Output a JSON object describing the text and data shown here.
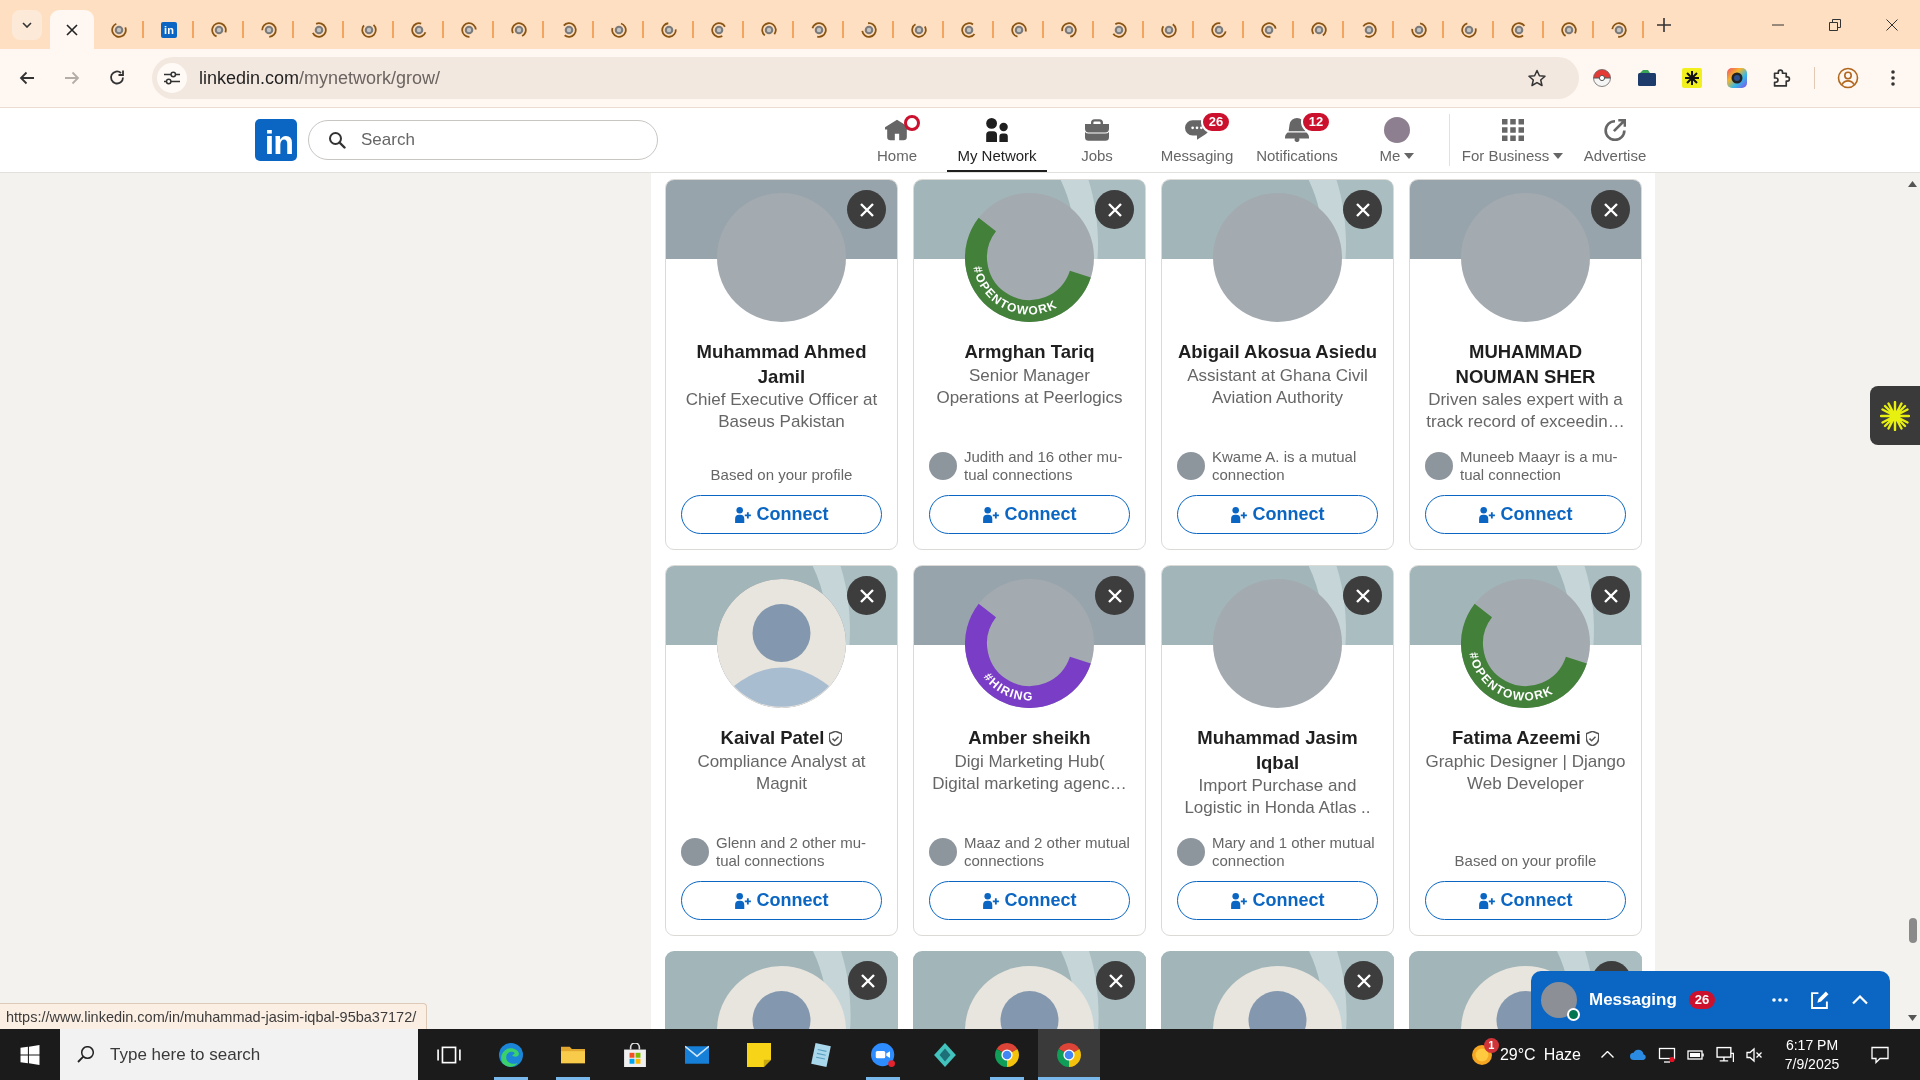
{
  "browser": {
    "tabs": [
      {
        "selected": true
      },
      {
        "selected": false,
        "kind": "loading"
      },
      {
        "selected": false,
        "kind": "logo",
        "logo": "in"
      },
      {
        "selected": false,
        "kind": "loading"
      },
      {
        "selected": false,
        "kind": "loading"
      },
      {
        "selected": false,
        "kind": "loading"
      },
      {
        "selected": false,
        "kind": "loading"
      },
      {
        "selected": false,
        "kind": "loading"
      },
      {
        "selected": false,
        "kind": "loading"
      },
      {
        "selected": false,
        "kind": "loading"
      },
      {
        "selected": false,
        "kind": "loading"
      },
      {
        "selected": false,
        "kind": "loading"
      },
      {
        "selected": false,
        "kind": "loading"
      },
      {
        "selected": false,
        "kind": "loading"
      },
      {
        "selected": false,
        "kind": "loading"
      },
      {
        "selected": false,
        "kind": "loading"
      },
      {
        "selected": false,
        "kind": "loading"
      },
      {
        "selected": false,
        "kind": "loading"
      },
      {
        "selected": false,
        "kind": "loading"
      },
      {
        "selected": false,
        "kind": "loading"
      },
      {
        "selected": false,
        "kind": "loading"
      },
      {
        "selected": false,
        "kind": "loading"
      },
      {
        "selected": false,
        "kind": "loading"
      },
      {
        "selected": false,
        "kind": "loading"
      },
      {
        "selected": false,
        "kind": "loading"
      },
      {
        "selected": false,
        "kind": "loading"
      },
      {
        "selected": false,
        "kind": "loading"
      },
      {
        "selected": false,
        "kind": "loading"
      },
      {
        "selected": false,
        "kind": "loading"
      },
      {
        "selected": false,
        "kind": "loading"
      },
      {
        "selected": false,
        "kind": "loading"
      },
      {
        "selected": false,
        "kind": "loading"
      }
    ],
    "nav_buttons": [
      {
        "kind": "back",
        "disabled": false
      },
      {
        "kind": "forward",
        "disabled": true
      },
      {
        "kind": "reload",
        "disabled": false
      }
    ],
    "address": {
      "host": "linkedin.com",
      "path": "/mynetwork/grow/"
    }
  },
  "header": {
    "logo": "in",
    "search": {
      "placeholder": "Search"
    },
    "nav": [
      {
        "kind": "home",
        "label": "Home",
        "selected": false,
        "dot": true,
        "dropdown": false
      },
      {
        "kind": "network",
        "label": "My Network",
        "selected": true,
        "dot": false,
        "dropdown": false
      },
      {
        "kind": "jobs",
        "label": "Jobs",
        "selected": false,
        "dot": false,
        "dropdown": false
      },
      {
        "kind": "messaging",
        "label": "Messaging",
        "selected": false,
        "dot": false,
        "dropdown": false,
        "badge": "26"
      },
      {
        "kind": "notifications",
        "label": "Notifications",
        "selected": false,
        "dot": false,
        "dropdown": false,
        "badge": "12"
      },
      {
        "kind": "me",
        "label": "Me",
        "selected": false,
        "dot": false,
        "dropdown": true
      },
      {
        "kind": "business",
        "label": "For Business",
        "selected": false,
        "dot": false,
        "dropdown": true
      },
      {
        "kind": "advertise",
        "label": "Advertise",
        "selected": false,
        "dot": false,
        "dropdown": false
      }
    ]
  },
  "cards": [
    {
      "banner": {
        "kind": "photo"
      },
      "avatar": {
        "kind": "photo"
      },
      "name": [
        "Muhammad Ahmed",
        "Jamil"
      ],
      "verified": false,
      "headline": [
        "Chief Executive Officer at",
        "Baseus Pakistan"
      ],
      "footer": {
        "kind": "note",
        "lines": [
          "Based on your profile"
        ]
      },
      "action": "Connect"
    },
    {
      "banner": {
        "kind": "default"
      },
      "avatar": {
        "kind": "photo"
      },
      "frame": {
        "kind": "open",
        "label": "#OPENTOWORK"
      },
      "name": [
        "Armghan Tariq"
      ],
      "verified": false,
      "headline": [
        "Senior Manager",
        "Operations at Peerlogics"
      ],
      "footer": {
        "kind": "mutual",
        "lines": [
          "Judith and 16 other mu-",
          "tual connections"
        ]
      },
      "action": "Connect"
    },
    {
      "banner": {
        "kind": "default"
      },
      "avatar": {
        "kind": "photo"
      },
      "name": [
        "Abigail Akosua Asiedu"
      ],
      "verified": false,
      "headline": [
        "Assistant at Ghana Civil",
        "Aviation Authority"
      ],
      "footer": {
        "kind": "mutual",
        "lines": [
          "Kwame A. is a mutual",
          "connection"
        ]
      },
      "action": "Connect"
    },
    {
      "banner": {
        "kind": "photo"
      },
      "avatar": {
        "kind": "photo"
      },
      "name": [
        "MUHAMMAD",
        "NOUMAN SHER"
      ],
      "verified": false,
      "headline": [
        "Driven sales expert with a",
        "track record of exceedin…"
      ],
      "footer": {
        "kind": "mutual",
        "lines": [
          "Muneeb Maayr is a mu-",
          "tual connection"
        ]
      },
      "action": "Connect"
    },
    {
      "banner": {
        "kind": "default"
      },
      "avatar": {
        "kind": "default"
      },
      "name": [
        "Kaival Patel"
      ],
      "verified": true,
      "headline": [
        "Compliance Analyst at",
        "Magnit"
      ],
      "footer": {
        "kind": "mutual",
        "lines": [
          "Glenn and 2 other mu-",
          "tual connections"
        ]
      },
      "action": "Connect"
    },
    {
      "banner": {
        "kind": "photo"
      },
      "avatar": {
        "kind": "photo"
      },
      "frame": {
        "kind": "hiring",
        "label": "#HIRING"
      },
      "name": [
        "Amber sheikh"
      ],
      "verified": false,
      "headline": [
        "Digi Marketing Hub(",
        "Digital marketing agenc…"
      ],
      "footer": {
        "kind": "mutual",
        "lines": [
          "Maaz and 2 other mutual",
          "connections"
        ]
      },
      "action": "Connect"
    },
    {
      "banner": {
        "kind": "default"
      },
      "avatar": {
        "kind": "photo"
      },
      "name": [
        "Muhammad Jasim",
        "Iqbal"
      ],
      "verified": false,
      "headline": [
        "Import Purchase and",
        "Logistic in Honda Atlas .."
      ],
      "footer": {
        "kind": "mutual",
        "lines": [
          "Mary and 1 other mutual",
          "connection"
        ]
      },
      "action": "Connect"
    },
    {
      "banner": {
        "kind": "default"
      },
      "avatar": {
        "kind": "photo"
      },
      "frame": {
        "kind": "open",
        "label": "#OPENTOWORK"
      },
      "name": [
        "Fatima Azeemi"
      ],
      "verified": true,
      "headline": [
        "Graphic Designer | Django",
        "Web Developer"
      ],
      "footer": {
        "kind": "note",
        "lines": [
          "Based on your profile"
        ]
      },
      "action": "Connect"
    },
    {
      "banner": {
        "kind": "default"
      },
      "avatar": {
        "kind": "default"
      }
    },
    {
      "banner": {
        "kind": "default"
      },
      "avatar": {
        "kind": "default"
      }
    },
    {
      "banner": {
        "kind": "default"
      },
      "avatar": {
        "kind": "default"
      }
    },
    {
      "banner": {
        "kind": "default"
      },
      "avatar": {
        "kind": "default"
      }
    }
  ],
  "messaging": {
    "title": "Messaging",
    "badge": "26",
    "online": true
  },
  "status_url": "https://www.linkedin.com/in/muhammad-jasim-iqbal-95ba37172/",
  "taskbar": {
    "search": {
      "placeholder": "Type here to search"
    },
    "apps": [
      {
        "kind": "taskview",
        "running": false,
        "selected": false
      },
      {
        "kind": "edge",
        "running": true,
        "selected": false
      },
      {
        "kind": "folder",
        "running": true,
        "selected": false
      },
      {
        "kind": "store",
        "running": false,
        "selected": false
      },
      {
        "kind": "mail",
        "running": false,
        "selected": false
      },
      {
        "kind": "notes",
        "running": false,
        "selected": false
      },
      {
        "kind": "paper",
        "running": false,
        "selected": false
      },
      {
        "kind": "zoom",
        "running": true,
        "selected": false
      },
      {
        "kind": "gem",
        "running": false,
        "selected": false
      },
      {
        "kind": "chrome",
        "running": true,
        "selected": false
      },
      {
        "kind": "chrome",
        "running": true,
        "selected": true
      }
    ],
    "weather": {
      "badge": "1",
      "temperature": "29°C",
      "condition": "Haze"
    },
    "time": "6:17 PM",
    "date": "7/9/2025"
  }
}
